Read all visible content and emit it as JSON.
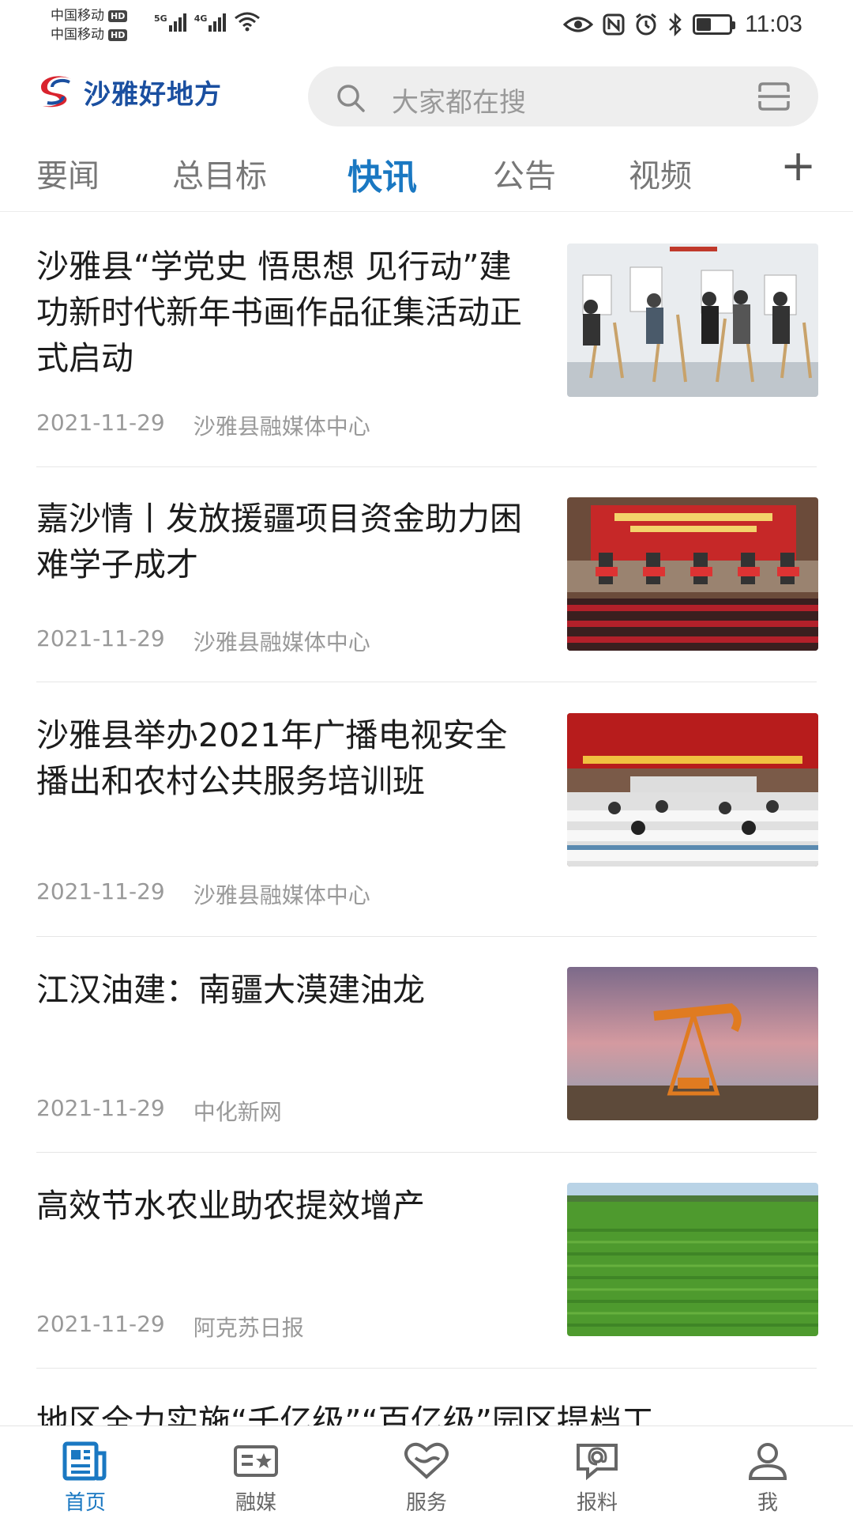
{
  "status_bar": {
    "carrier_1": "中国移动",
    "carrier_2": "中国移动",
    "hd": "HD",
    "net_1": "5G",
    "net_2": "4G",
    "time": "11:03",
    "battery_level": 0.45
  },
  "header": {
    "logo_text": "沙雅好地方",
    "search_placeholder": "大家都在搜"
  },
  "tabs": {
    "items": [
      "要闻",
      "总目标",
      "快讯",
      "公告",
      "视频"
    ],
    "active_index": 2,
    "more_symbol": "+"
  },
  "news": [
    {
      "title": "沙雅县“学党史 悟思想 见行动”建功新时代新年书画作品征集活动正式启动",
      "date": "2021-11-29",
      "source": "沙雅县融媒体中心",
      "thumb": "art-exhibition"
    },
    {
      "title": "嘉沙情丨发放援疆项目资金助力困难学子成才",
      "date": "2021-11-29",
      "source": "沙雅县融媒体中心",
      "thumb": "ceremony-stage"
    },
    {
      "title": "沙雅县举办2021年广播电视安全播出和农村公共服务培训班",
      "date": "2021-11-29",
      "source": "沙雅县融媒体中心",
      "thumb": "training-hall"
    },
    {
      "title": "江汉油建：南疆大漠建油龙",
      "date": "2021-11-29",
      "source": "中化新网",
      "thumb": "oil-pump"
    },
    {
      "title": "高效节水农业助农提效增产",
      "date": "2021-11-29",
      "source": "阿克苏日报",
      "thumb": "green-field"
    },
    {
      "title": "地区全力实施“千亿级”“百亿级”园区提档工"
    }
  ],
  "bottom_nav": {
    "items": [
      {
        "label": "首页",
        "icon": "news-icon"
      },
      {
        "label": "融媒",
        "icon": "media-card-icon"
      },
      {
        "label": "服务",
        "icon": "heart-hands-icon"
      },
      {
        "label": "报料",
        "icon": "chat-at-icon"
      },
      {
        "label": "我",
        "icon": "user-icon"
      }
    ],
    "active_index": 0
  },
  "colors": {
    "accent": "#1a78c2",
    "brand": "#1a4fa0",
    "logo_red": "#d9232d"
  }
}
